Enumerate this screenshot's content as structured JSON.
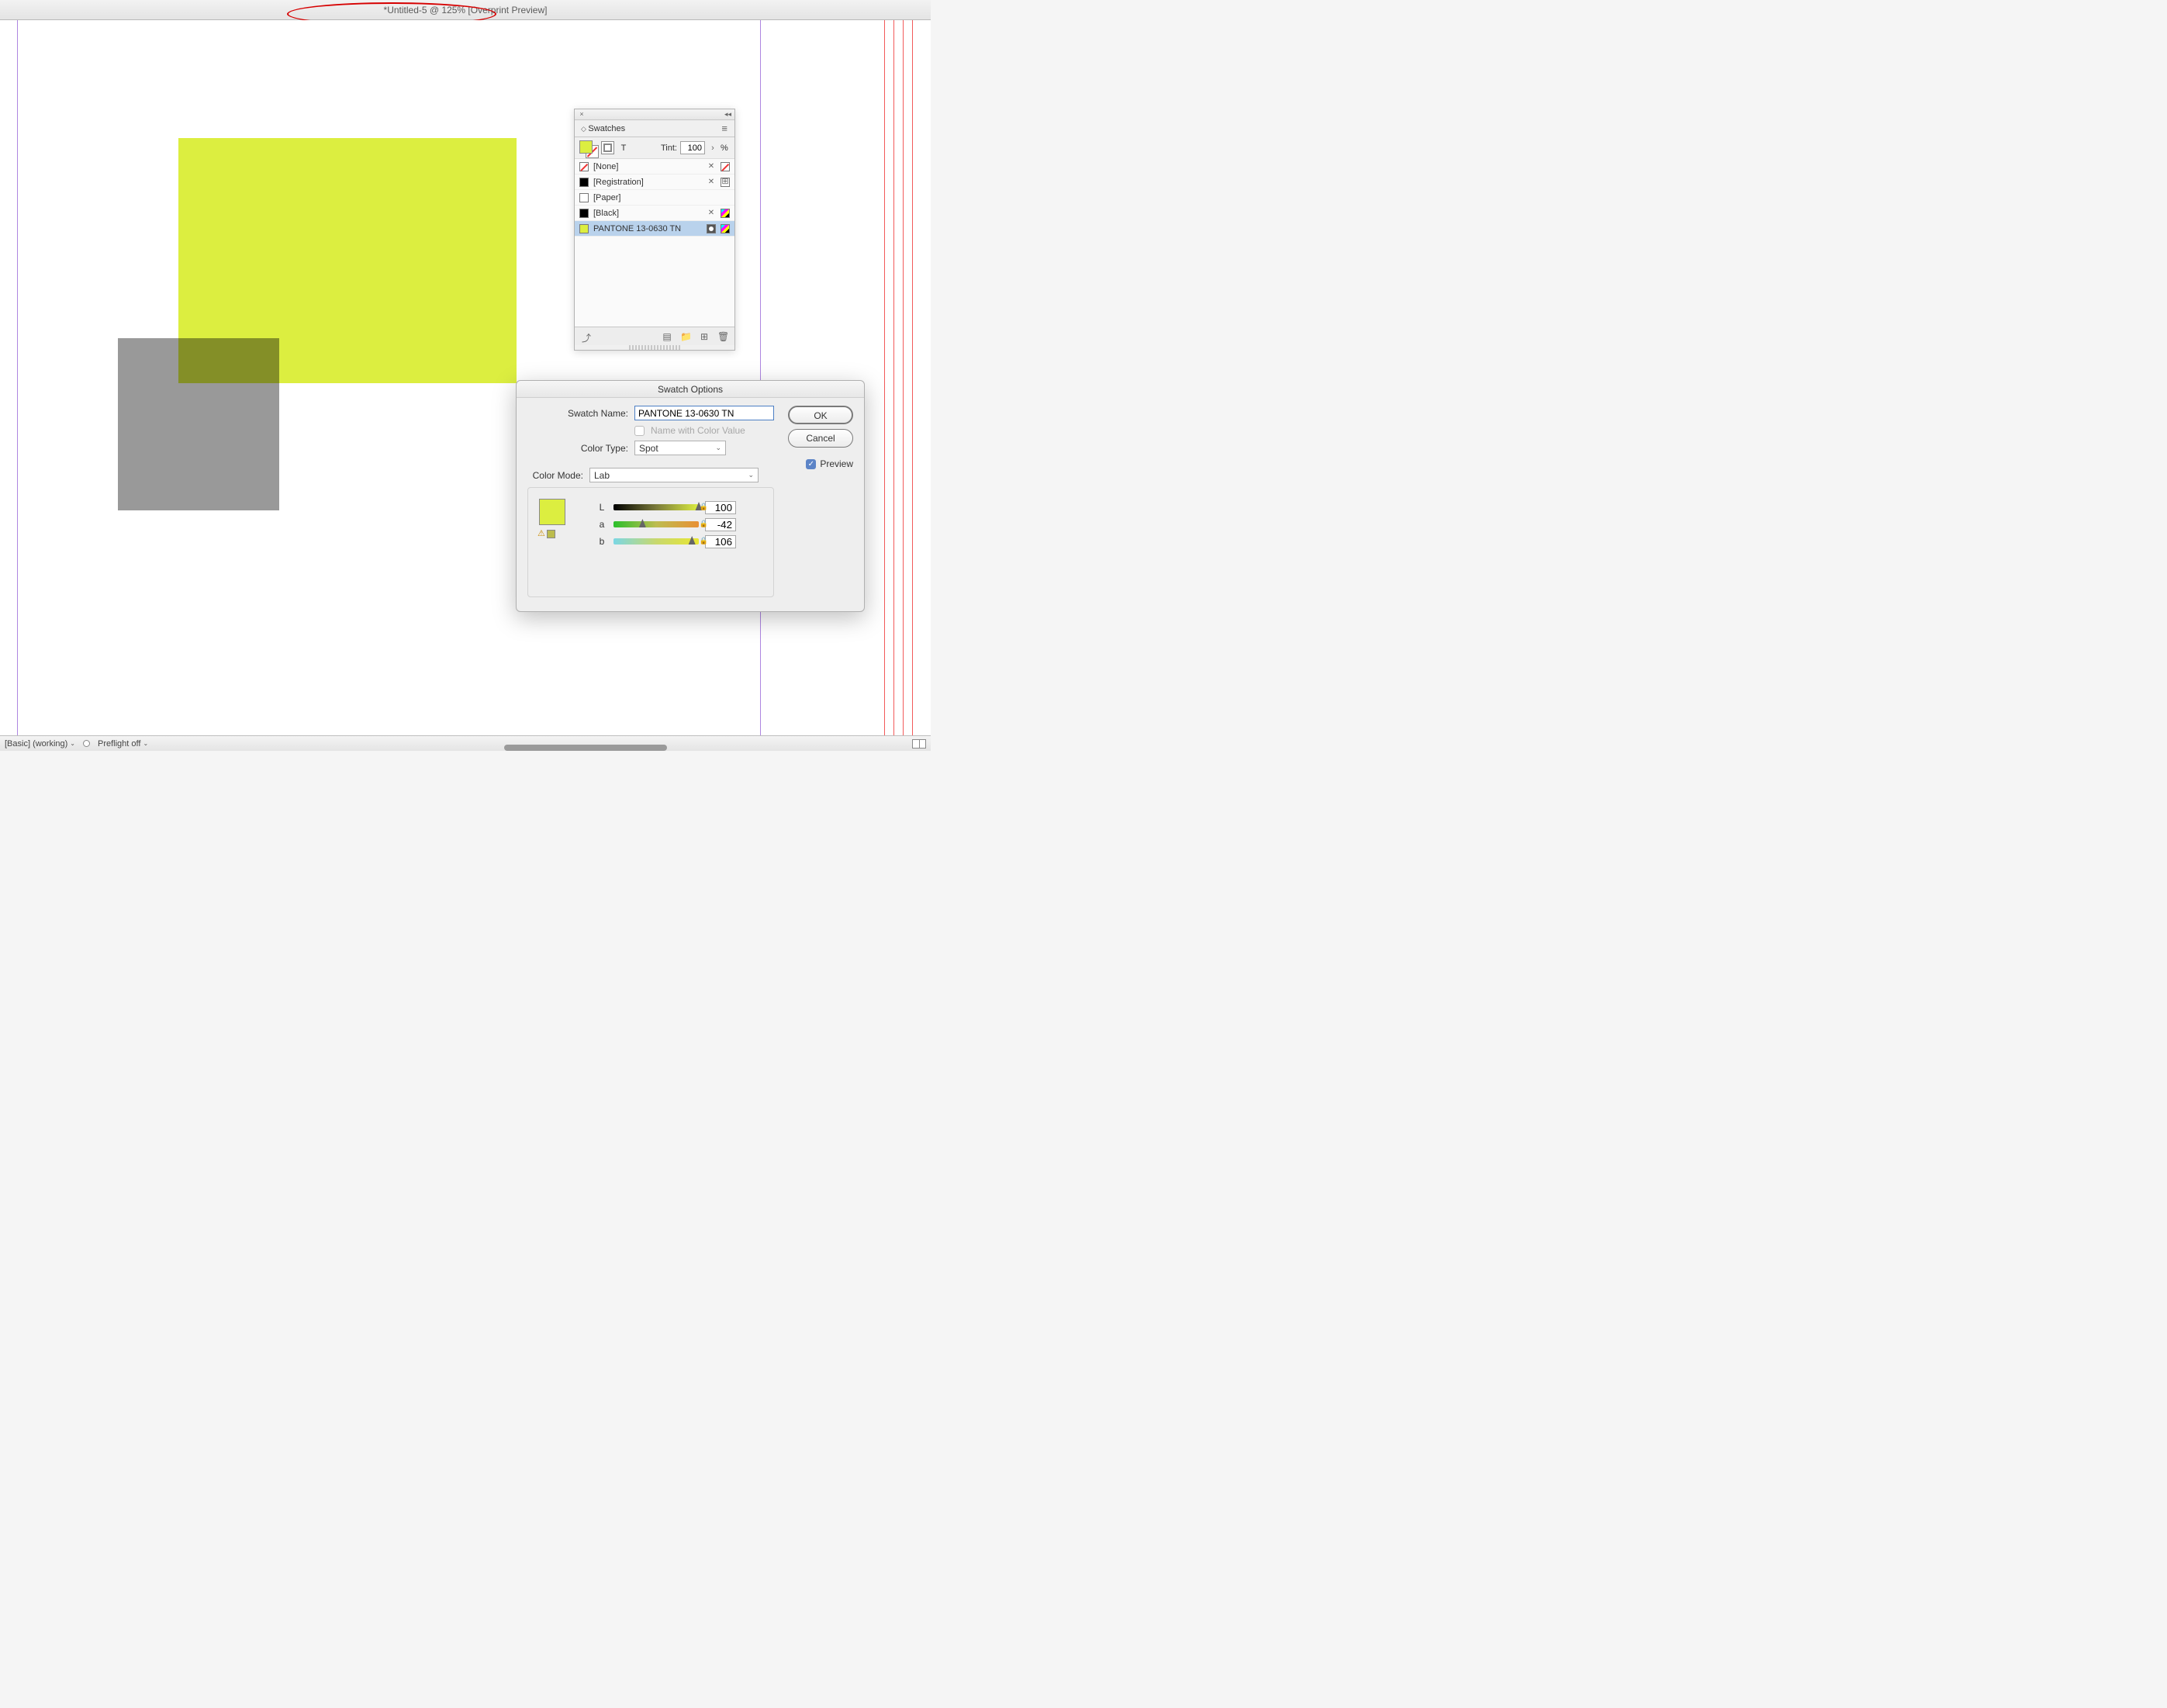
{
  "title_bar": "*Untitled-5 @ 125% [Overprint Preview]",
  "swatches_panel": {
    "title": "Swatches",
    "tint_label": "Tint:",
    "tint_value": "100",
    "tint_unit": "%",
    "items": [
      {
        "name": "[None]"
      },
      {
        "name": "[Registration]"
      },
      {
        "name": "[Paper]"
      },
      {
        "name": "[Black]"
      },
      {
        "name": "PANTONE 13-0630 TN"
      }
    ]
  },
  "dialog": {
    "title": "Swatch Options",
    "swatch_name_label": "Swatch Name:",
    "swatch_name_value": "PANTONE 13-0630 TN",
    "name_with_value_label": "Name with Color Value",
    "color_type_label": "Color Type:",
    "color_type_value": "Spot",
    "color_mode_label": "Color Mode:",
    "color_mode_value": "Lab",
    "L_label": "L",
    "a_label": "a",
    "b_label": "b",
    "L_value": "100",
    "a_value": "-42",
    "b_value": "106",
    "ok_label": "OK",
    "cancel_label": "Cancel",
    "preview_label": "Preview"
  },
  "status_bar": {
    "profile": "[Basic] (working)",
    "preflight": "Preflight off"
  }
}
